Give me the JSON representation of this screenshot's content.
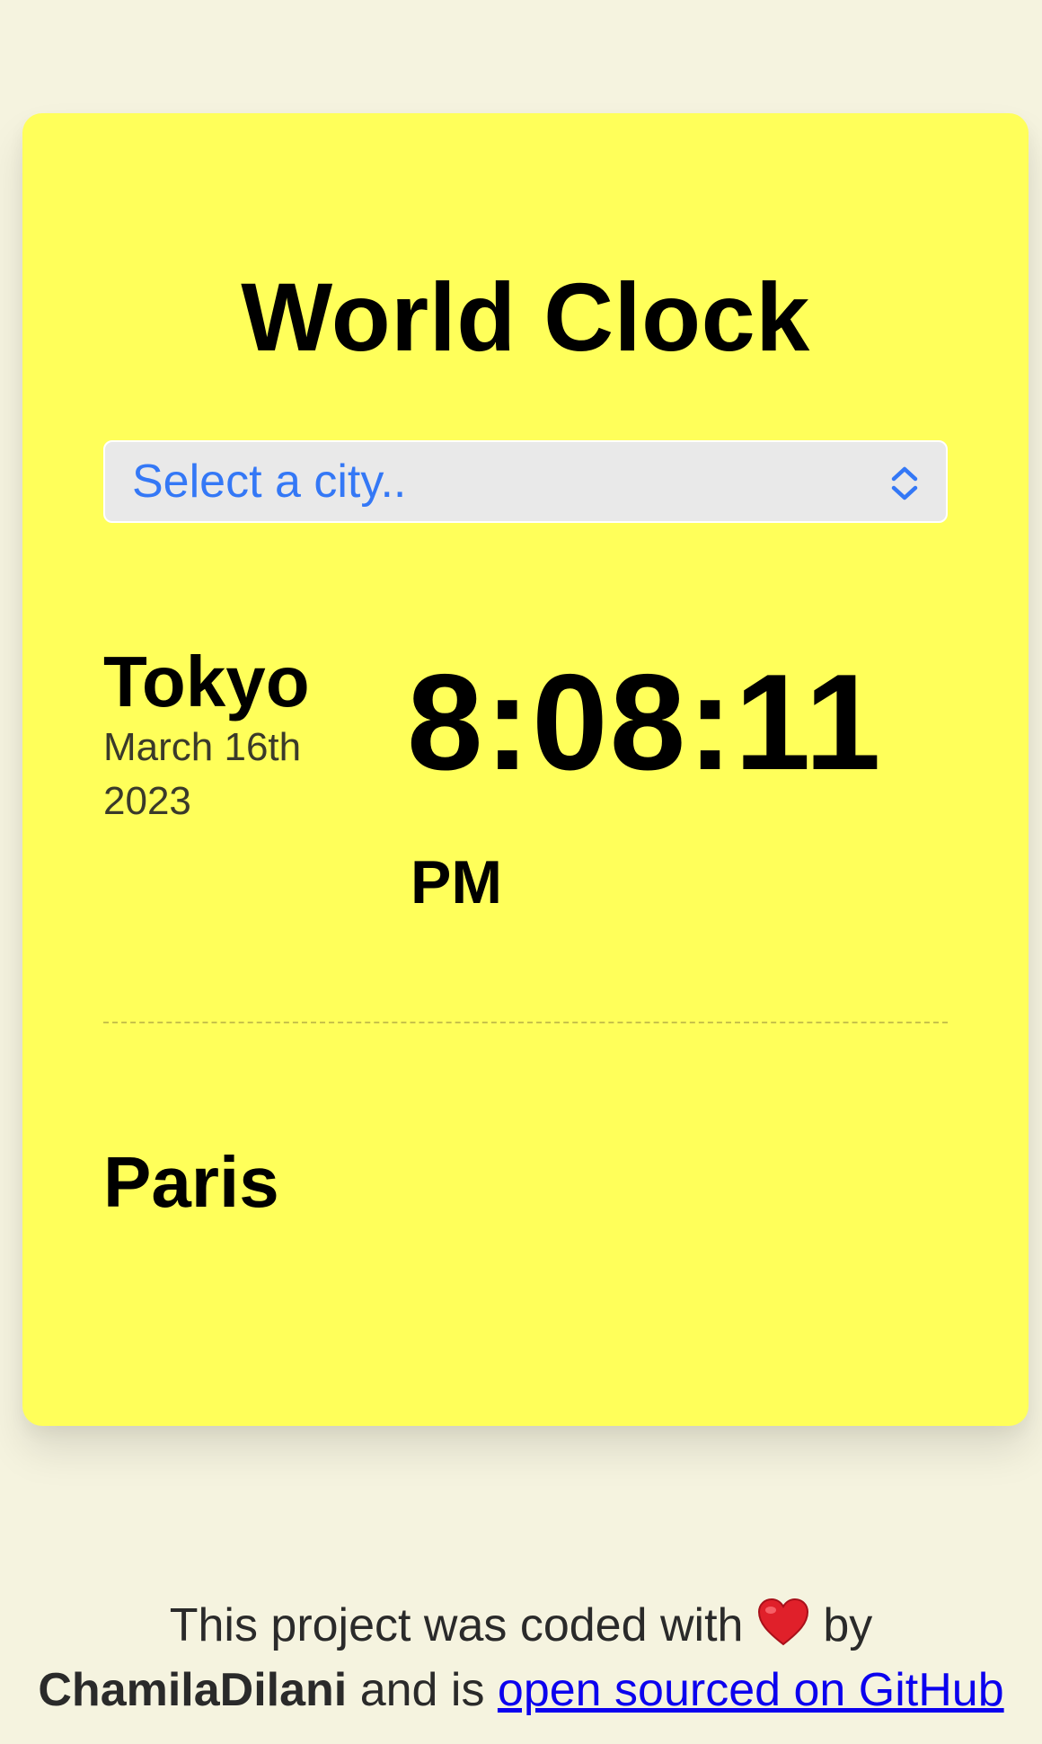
{
  "app": {
    "title": "World Clock"
  },
  "city_select": {
    "placeholder": "Select a city.."
  },
  "cities": [
    {
      "name": "Tokyo",
      "date_line1": "March 16th",
      "date_line2": "2023",
      "time": "8:08:11",
      "ampm": "PM"
    },
    {
      "name": "Paris"
    }
  ],
  "footer": {
    "text_before_heart": "This project was coded with",
    "heart_icon": "red-heart-emoji",
    "text_after_heart": "by",
    "author": "ChamilaDilani",
    "text_middle": "and is",
    "link_text": "open sourced on GitHub"
  },
  "colors": {
    "page_background": "#f5f3df",
    "card_background": "#ffff5a",
    "select_text": "#3478f6",
    "link": "#0b00ee"
  }
}
